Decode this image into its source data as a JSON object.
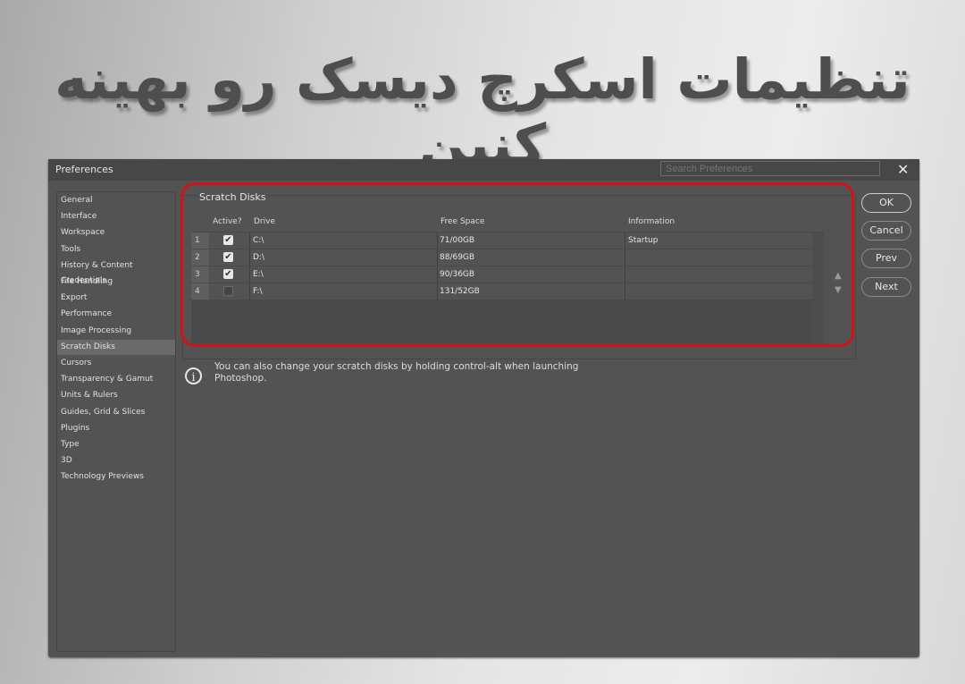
{
  "headline": "تنظیمات اسکرچ دیسک رو بهینه کنین",
  "dialog": {
    "title": "Preferences",
    "search_placeholder": "Search Preferences",
    "close_icon": "close-icon"
  },
  "sidebar": {
    "active": "Scratch Disks",
    "items": [
      {
        "label": "General"
      },
      {
        "label": "Interface"
      },
      {
        "label": "Workspace"
      },
      {
        "label": "Tools"
      },
      {
        "label": "History & Content Credentials"
      },
      {
        "label": "File Handling"
      },
      {
        "label": "Export"
      },
      {
        "label": "Performance"
      },
      {
        "label": "Image Processing"
      },
      {
        "label": "Scratch Disks"
      },
      {
        "label": "Cursors"
      },
      {
        "label": "Transparency & Gamut"
      },
      {
        "label": "Units & Rulers"
      },
      {
        "label": "Guides, Grid & Slices"
      },
      {
        "label": "Plugins"
      },
      {
        "label": "Type"
      },
      {
        "label": "3D"
      },
      {
        "label": "Technology Previews"
      }
    ]
  },
  "scratch_disks": {
    "group_label": "Scratch Disks",
    "columns": {
      "active": "Active?",
      "drive": "Drive",
      "free_space": "Free Space",
      "information": "Information"
    },
    "rows": [
      {
        "num": "1",
        "active": true,
        "drive": "C:\\",
        "free_space": "71/00GB",
        "information": "Startup"
      },
      {
        "num": "2",
        "active": true,
        "drive": "D:\\",
        "free_space": "88/69GB",
        "information": ""
      },
      {
        "num": "3",
        "active": true,
        "drive": "E:\\",
        "free_space": "90/36GB",
        "information": ""
      },
      {
        "num": "4",
        "active": false,
        "drive": "F:\\",
        "free_space": "131/52GB",
        "information": ""
      }
    ],
    "move_up_icon": "▲",
    "move_down_icon": "▼",
    "checkmark": "✔"
  },
  "note": {
    "line1": "You can also change your scratch disks by holding control-alt when launching",
    "line2": "Photoshop.",
    "icon": "i"
  },
  "buttons": {
    "ok": "OK",
    "cancel": "Cancel",
    "prev": "Prev",
    "next": "Next"
  },
  "colors": {
    "highlight": "#d4111b",
    "dialog_bg": "#535353"
  }
}
